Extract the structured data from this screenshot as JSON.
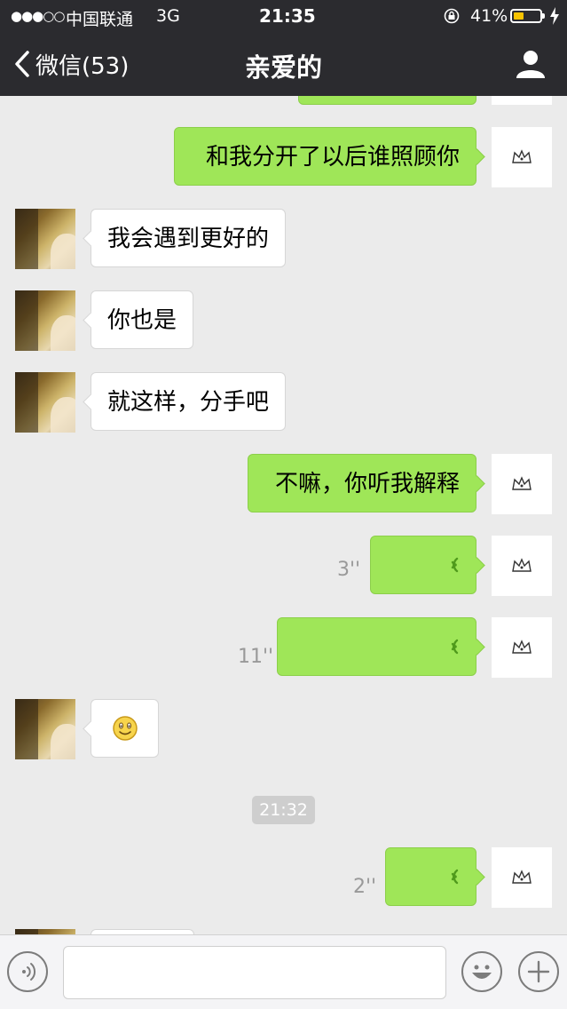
{
  "status_bar": {
    "signal": "●●●○○",
    "carrier": "中国联通",
    "network": "3G",
    "time": "21:35",
    "battery_percent": "41%",
    "battery_level": 0.41
  },
  "nav": {
    "back_label": "微信(53)",
    "title": "亲爱的"
  },
  "messages": [
    {
      "side": "out",
      "type": "text",
      "text": "和我分开了以后谁照顾你"
    },
    {
      "side": "in",
      "type": "text",
      "text": "我会遇到更好的"
    },
    {
      "side": "in",
      "type": "text",
      "text": "你也是"
    },
    {
      "side": "in",
      "type": "text",
      "text": "就这样，分手吧"
    },
    {
      "side": "out",
      "type": "text",
      "text": "不嘛，你听我解释"
    },
    {
      "side": "out",
      "type": "voice",
      "duration": "3''"
    },
    {
      "side": "out",
      "type": "voice",
      "duration": "11''"
    },
    {
      "side": "in",
      "type": "emoji",
      "text": "☺"
    },
    {
      "type": "timestamp",
      "text": "21:32"
    },
    {
      "side": "out",
      "type": "voice",
      "duration": "2''"
    }
  ],
  "colors": {
    "nav_background": "#2b2b2f",
    "chat_background": "#ebebeb",
    "outgoing_bubble": "#9fe658",
    "incoming_bubble": "#ffffff",
    "battery_fill": "#f7c300"
  }
}
